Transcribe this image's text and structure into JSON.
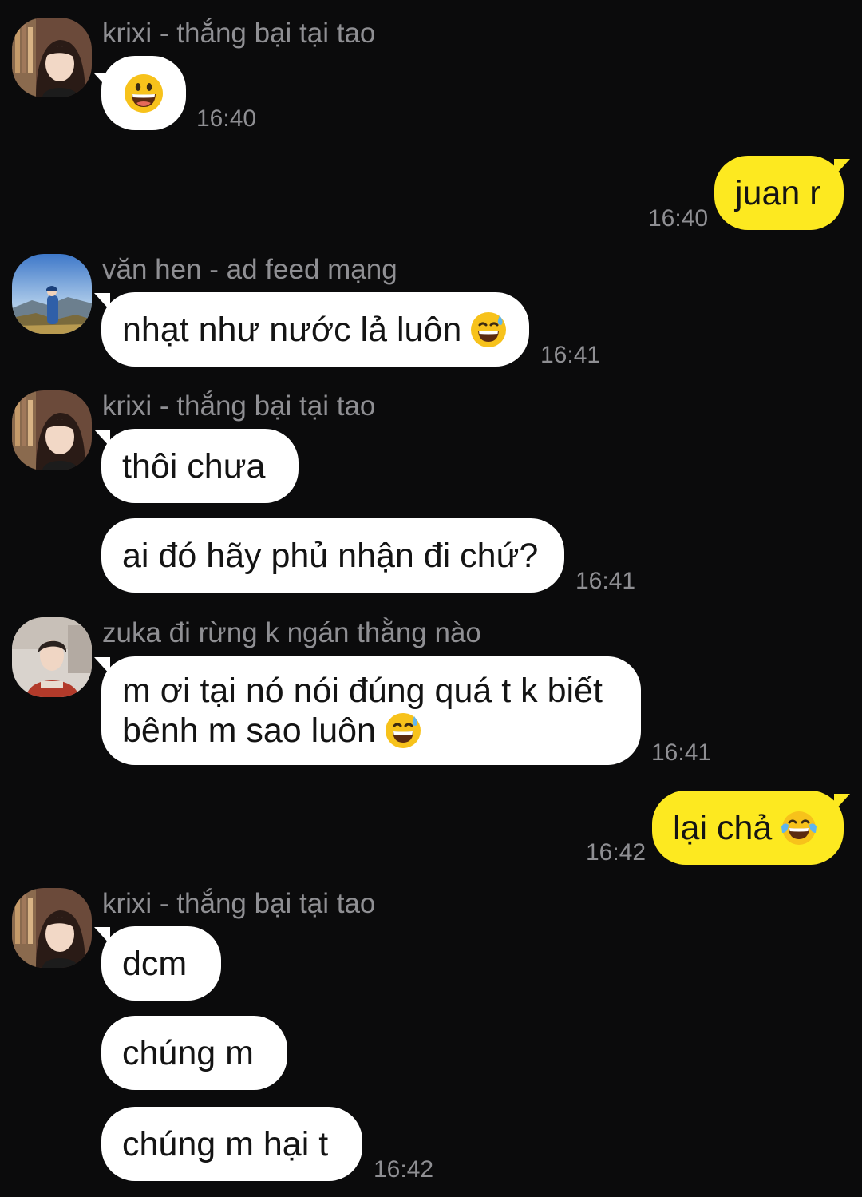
{
  "messages": {
    "m1": {
      "sender": "krixi - thắng bại tại tao",
      "emoji": "grinning-face",
      "time": "16:40"
    },
    "m2": {
      "text": "juan r",
      "time": "16:40"
    },
    "m3": {
      "sender": "văn hen - ad feed mạng",
      "text": "nhạt như nước lả luôn",
      "emoji": "grinning-sweat-face",
      "time": "16:41"
    },
    "m4": {
      "sender": "krixi - thắng bại tại tao",
      "text1": "thôi chưa",
      "text2": "ai đó hãy phủ nhận đi chứ?",
      "time": "16:41"
    },
    "m5": {
      "sender": "zuka đi rừng k ngán thằng nào",
      "line1": "m ơi tại nó nói đúng quá t k biết",
      "line2": "bênh m sao luôn",
      "emoji": "grinning-sweat-face",
      "time": "16:41"
    },
    "m6": {
      "text": "lại chả",
      "emoji": "tears-of-joy-face",
      "time": "16:42"
    },
    "m7": {
      "sender": "krixi - thắng bại tại tao",
      "text1": "dcm",
      "text2": "chúng m",
      "text3": "chúng m hại t",
      "time": "16:42"
    }
  },
  "colors": {
    "background": "#0b0b0c",
    "incoming_bubble": "#ffffff",
    "outgoing_bubble": "#fde920",
    "meta_text": "#8f8f93"
  }
}
